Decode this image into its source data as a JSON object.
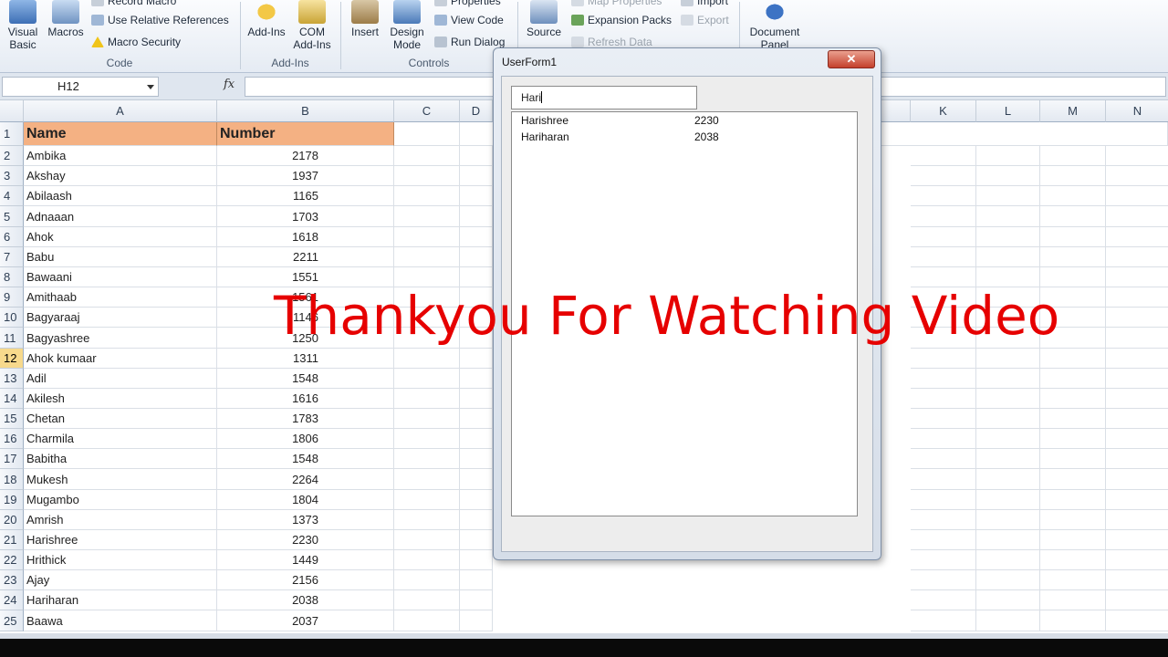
{
  "ribbon": {
    "code": {
      "group_label": "Code",
      "visual_basic": "Visual\nBasic",
      "macros": "Macros",
      "record_macro": "Record Macro",
      "use_relative": "Use Relative References",
      "macro_security": "Macro Security"
    },
    "addins": {
      "group_label": "Add-Ins",
      "addins": "Add-Ins",
      "com_addins": "COM\nAdd-Ins"
    },
    "controls": {
      "group_label": "Controls",
      "insert": "Insert",
      "design_mode": "Design\nMode",
      "properties": "Properties",
      "view_code": "View Code",
      "run_dialog": "Run Dialog"
    },
    "xml": {
      "source": "Source",
      "map_properties": "Map Properties",
      "expansion_packs": "Expansion Packs",
      "refresh_data": "Refresh Data",
      "import": "Import",
      "export": "Export"
    },
    "modify": {
      "document_panel": "Document\nPanel"
    }
  },
  "formula_bar": {
    "name_box": "H12",
    "fx_symbol": "fx"
  },
  "grid": {
    "columns": [
      "A",
      "B",
      "C",
      "D",
      "K",
      "L",
      "M",
      "N"
    ],
    "header_row": {
      "row": "1",
      "name": "Name",
      "number": "Number"
    },
    "rows": [
      {
        "row": "2",
        "name": "Ambika",
        "number": "2178"
      },
      {
        "row": "3",
        "name": "Akshay",
        "number": "1937"
      },
      {
        "row": "4",
        "name": "Abilaash",
        "number": "1165"
      },
      {
        "row": "5",
        "name": "Adnaaan",
        "number": "1703"
      },
      {
        "row": "6",
        "name": "Ahok",
        "number": "1618"
      },
      {
        "row": "7",
        "name": "Babu",
        "number": "2211"
      },
      {
        "row": "8",
        "name": "Bawaani",
        "number": "1551"
      },
      {
        "row": "9",
        "name": "Amithaab",
        "number": "1561"
      },
      {
        "row": "10",
        "name": "Bagyaraaj",
        "number": "1146"
      },
      {
        "row": "11",
        "name": "Bagyashree",
        "number": "1250"
      },
      {
        "row": "12",
        "name": "Ahok kumaar",
        "number": "1311"
      },
      {
        "row": "13",
        "name": "Adil",
        "number": "1548"
      },
      {
        "row": "14",
        "name": "Akilesh",
        "number": "1616"
      },
      {
        "row": "15",
        "name": "Chetan",
        "number": "1783"
      },
      {
        "row": "16",
        "name": "Charmila",
        "number": "1806"
      },
      {
        "row": "17",
        "name": "Babitha",
        "number": "1548"
      },
      {
        "row": "18",
        "name": "Mukesh",
        "number": "2264"
      },
      {
        "row": "19",
        "name": "Mugambo",
        "number": "1804"
      },
      {
        "row": "20",
        "name": "Amrish",
        "number": "1373"
      },
      {
        "row": "21",
        "name": "Harishree",
        "number": "2230"
      },
      {
        "row": "22",
        "name": "Hrithick",
        "number": "1449"
      },
      {
        "row": "23",
        "name": "Ajay",
        "number": "2156"
      },
      {
        "row": "24",
        "name": "Hariharan",
        "number": "2038"
      },
      {
        "row": "25",
        "name": "Baawa",
        "number": "2037"
      }
    ],
    "selected_row": "12"
  },
  "userform": {
    "title": "UserForm1",
    "close_glyph": "✕",
    "search_value": "Hari",
    "results": [
      {
        "name": "Harishree",
        "number": "2230"
      },
      {
        "name": "Hariharan",
        "number": "2038"
      }
    ]
  },
  "caption": "Thankyou For Watching Video",
  "colors": {
    "header_fill": "#f4b183",
    "caption": "#e60000",
    "selected_row": "#f7d98c"
  }
}
